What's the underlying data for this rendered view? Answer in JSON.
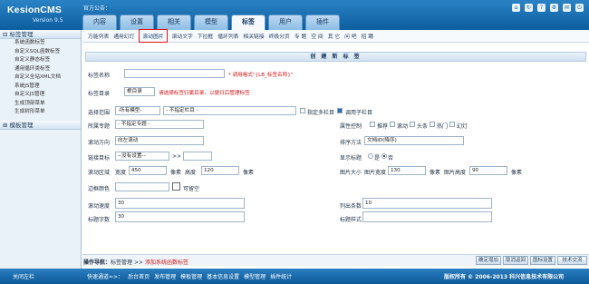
{
  "header": {
    "logo": "KesionCMS",
    "version": "Version 9.5",
    "notice": "官方公告：",
    "tabs": [
      "内容",
      "设置",
      "相关",
      "模型",
      "标签",
      "用户",
      "插件"
    ],
    "active_tab": 4,
    "tool_icons": [
      "home-icon",
      "refresh-icon",
      "help-icon",
      "settings-icon",
      "mail-icon",
      "logout-icon"
    ]
  },
  "sidebar": {
    "section1": "标签管理",
    "items": [
      "系统函数标签",
      "自定义SQL函数标签",
      "自定义静态标签",
      "通用循环类标签",
      "自定义全站XML文档",
      "系统JS管理",
      "自定义JS管理",
      "生成顶部菜单",
      "生成树形菜单"
    ],
    "section2": "模板管理"
  },
  "subnav": [
    "万能列表",
    "通用幻灯",
    "滚动图片",
    "滚动文字",
    "下拉框",
    "循环列表",
    "相关链接",
    "终极分页",
    "专 题",
    "空 间",
    "其 它",
    "问 吧",
    "招 聘"
  ],
  "subnav_active": 2,
  "form": {
    "title": "创 建 新 标 签",
    "tag_name_label": "标签名称",
    "tag_name_hint": "* 调用格式\"{LB_标签名称}\"",
    "tag_dir_label": "标签目录",
    "tag_dir_value": "根目录",
    "tag_dir_hint": "请选择标签归属目录，以便日后管理标签",
    "scope_label": "选择范围",
    "scope_model": "-所有模型-",
    "scope_column": "- 不指定栏目 -",
    "multi_column": "指定多栏目",
    "call_sub": "调用子栏目",
    "special_label": "所属专题",
    "special_value": "- 不指定专题 -",
    "attr_label": "属性控制",
    "attrs": [
      "推荐",
      "滚动",
      "头条",
      "热门",
      "幻灯"
    ],
    "direction_label": "滚动方向",
    "direction_value": "向左滚动",
    "sort_label": "排序方法",
    "sort_value": "文档ID(降序)",
    "target_label": "链接目标",
    "target_value": "--没有设置--",
    "show_title_label": "显示标题",
    "show_yes": "是",
    "show_no": "否",
    "area_label": "滚动区域",
    "width_label": "宽度",
    "width_value": "450",
    "px1": "像素",
    "height_label": "高度",
    "height_value": "120",
    "px2": "像素",
    "img_size_label": "图片大小",
    "img_w_label": "图片宽度",
    "img_w_value": "130",
    "px3": "像素",
    "img_h_label": "图片高度",
    "img_h_value": "90",
    "px4": "像素",
    "border_label": "边框颜色",
    "transparent": "可留空",
    "speed_label": "滚动速度",
    "speed_value": "30",
    "count_label": "列出条数",
    "count_value": "10",
    "chars_label": "标题字数",
    "chars_value": "30",
    "style_label": "标题样式"
  },
  "bottom": {
    "crumb_prefix": "操作导航：",
    "crumb_1": "标签管理",
    "crumb_sep": ">>",
    "crumb_2": "添加系统函数标签",
    "buttons": [
      "确定增加",
      "取消返回",
      "图标设置",
      "技术交流"
    ]
  },
  "footer": {
    "left": "关闭左栏",
    "quick": "快速通道=>：",
    "links": [
      "后台首页",
      "发布管理",
      "模板管理",
      "基本信息设置",
      "模型管理",
      "插件统计"
    ],
    "copyright": "版权所有 © 2006-2013 科兴信息技术有限公司"
  }
}
